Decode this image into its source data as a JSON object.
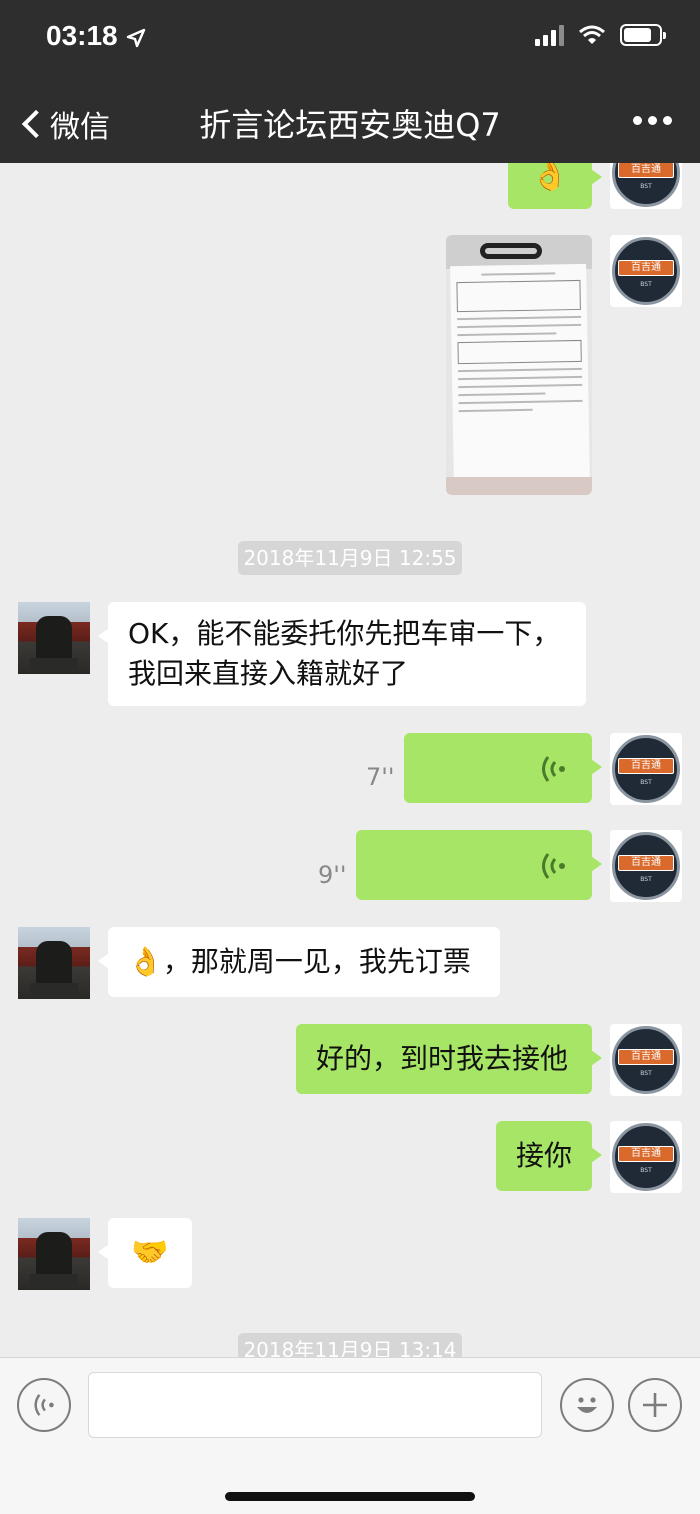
{
  "status_bar": {
    "time": "03:18"
  },
  "nav": {
    "back_label": "微信",
    "title": "折言论坛西安奥迪Q7"
  },
  "avatars": {
    "self_badge": "百吉通",
    "self_small": "BST"
  },
  "messages": {
    "m0": {
      "content": "👌"
    },
    "ts1": {
      "text": "2018年11月9日 12:55"
    },
    "m2_line1": "OK，能不能委托你先把车审一下，",
    "m2_line2": "我回来直接入籍就好了",
    "m3": {
      "duration": "7''"
    },
    "m4": {
      "duration": "9''"
    },
    "m5": {
      "text": "👌，那就周一见，我先订票"
    },
    "m6": {
      "text": "好的，到时我去接他"
    },
    "m7": {
      "text": "接你"
    },
    "m8": {
      "content": "🤝"
    },
    "ts2": {
      "text": "2018年11月9日 13:14"
    }
  },
  "input": {
    "placeholder": ""
  },
  "icons": {
    "voice_record": "voice-icon",
    "emoji": "emoji-icon",
    "add": "add-icon"
  },
  "colors": {
    "nav_bg": "#2e2e2e",
    "chat_bg": "#ededed",
    "self_bubble": "#a6e565",
    "other_bubble": "#ffffff"
  }
}
